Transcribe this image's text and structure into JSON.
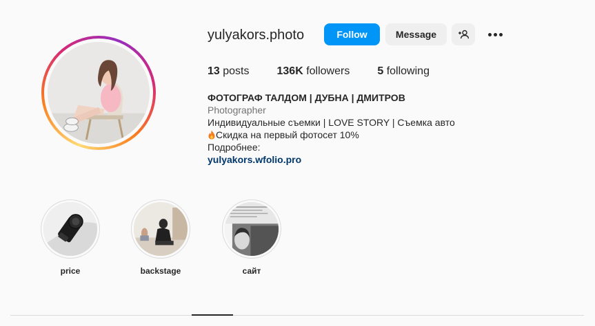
{
  "profile": {
    "username": "yulyakors.photo",
    "avatar_icon": "profile-photo"
  },
  "actions": {
    "follow_label": "Follow",
    "message_label": "Message",
    "add_user_icon": "add-user-icon",
    "more_icon": "more-options-icon"
  },
  "stats": {
    "posts_count": "13",
    "posts_label": "posts",
    "followers_count": "136K",
    "followers_label": "followers",
    "following_count": "5",
    "following_label": "following"
  },
  "bio": {
    "name": "ФОТОГРАФ ТАЛДОМ | ДУБНА | ДМИТРОВ",
    "category": "Photographer",
    "line1": "Индивидуальные съемки | LOVE STORY | Съемка авто",
    "line2": "Скидка на первый фотосет 10%",
    "line3": "Подробнее:",
    "link": "yulyakors.wfolio.pro"
  },
  "highlights": [
    {
      "label": "price"
    },
    {
      "label": "backstage"
    },
    {
      "label": "сайт"
    }
  ],
  "colors": {
    "accent": "#0095f6",
    "link": "#00376b",
    "secondary_text": "#737373"
  }
}
